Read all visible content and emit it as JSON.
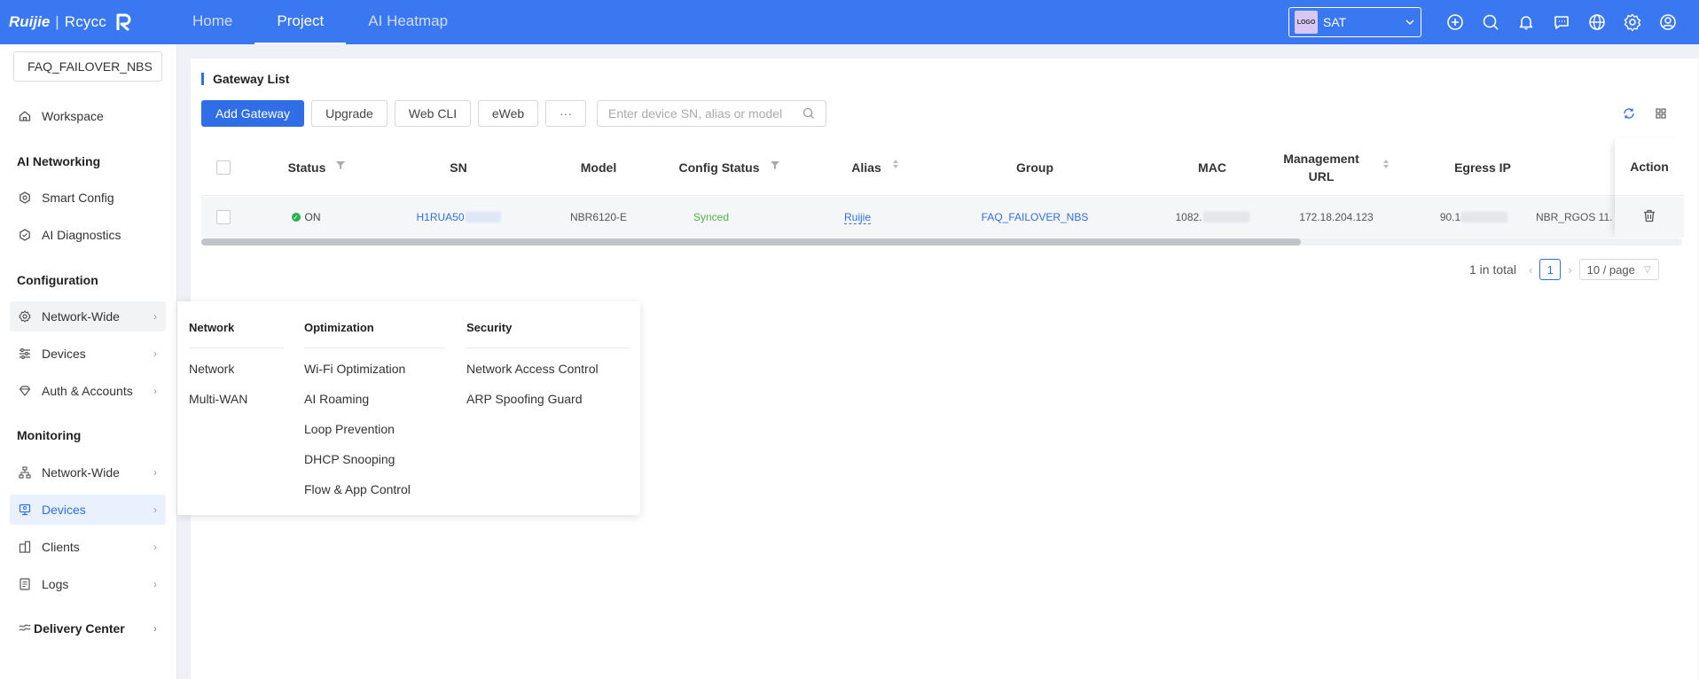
{
  "brand": {
    "name": "Ruijie",
    "sub": "Rcycc"
  },
  "topnav": {
    "tabs": [
      {
        "label": "Home"
      },
      {
        "label": "Project"
      },
      {
        "label": "AI Heatmap"
      }
    ],
    "active": "Project"
  },
  "project_select": {
    "logo_text": "LOGO",
    "value": "SAT"
  },
  "top_icons": [
    "add-circle-icon",
    "search-icon",
    "bell-icon",
    "message-icon",
    "globe-icon",
    "gear-icon",
    "user-icon"
  ],
  "sidebar": {
    "project_value": "FAQ_FAILOVER_NBS",
    "workspace": "Workspace",
    "ai_networking": {
      "title": "AI Networking",
      "items": [
        "Smart Config",
        "AI Diagnostics"
      ]
    },
    "configuration": {
      "title": "Configuration",
      "items": [
        "Network-Wide",
        "Devices",
        "Auth & Accounts"
      ]
    },
    "monitoring": {
      "title": "Monitoring",
      "items": [
        "Network-Wide",
        "Devices",
        "Clients",
        "Logs"
      ]
    },
    "delivery_center": "Delivery Center"
  },
  "card": {
    "title": "Gateway List",
    "buttons": {
      "add": "Add Gateway",
      "upgrade": "Upgrade",
      "webcli": "Web CLI",
      "eweb": "eWeb",
      "more": "···"
    },
    "search_placeholder": "Enter device SN, alias or model"
  },
  "table": {
    "headers": {
      "status": "Status",
      "sn": "SN",
      "model": "Model",
      "config_status": "Config Status",
      "alias": "Alias",
      "group": "Group",
      "mac": "MAC",
      "mgmt_url_1": "Management",
      "mgmt_url_2": "URL",
      "egress_ip": "Egress IP",
      "action": "Action"
    },
    "row": {
      "status": "ON",
      "sn": "H1RUA50",
      "model": "NBR6120-E",
      "config_status": "Synced",
      "alias": "Ruijie",
      "group": "FAQ_FAILOVER_NBS",
      "mac": "1082.",
      "mgmt_url": "172.18.204.123",
      "egress_ip": "90.1",
      "firmware": "NBR_RGOS 11."
    }
  },
  "pagination": {
    "total": "1 in total",
    "page": "1",
    "page_size": "10 / page"
  },
  "flyout": {
    "network": {
      "title": "Network",
      "items": [
        "Network",
        "Multi-WAN"
      ]
    },
    "optimization": {
      "title": "Optimization",
      "items": [
        "Wi-Fi Optimization",
        "AI Roaming",
        "Loop Prevention",
        "DHCP Snooping",
        "Flow & App Control"
      ]
    },
    "security": {
      "title": "Security",
      "items": [
        "Network Access Control",
        "ARP Spoofing Guard"
      ]
    }
  },
  "colors": {
    "primary": "#2f6ee6",
    "topbar": "#3a78f2",
    "success": "#52b44a"
  }
}
